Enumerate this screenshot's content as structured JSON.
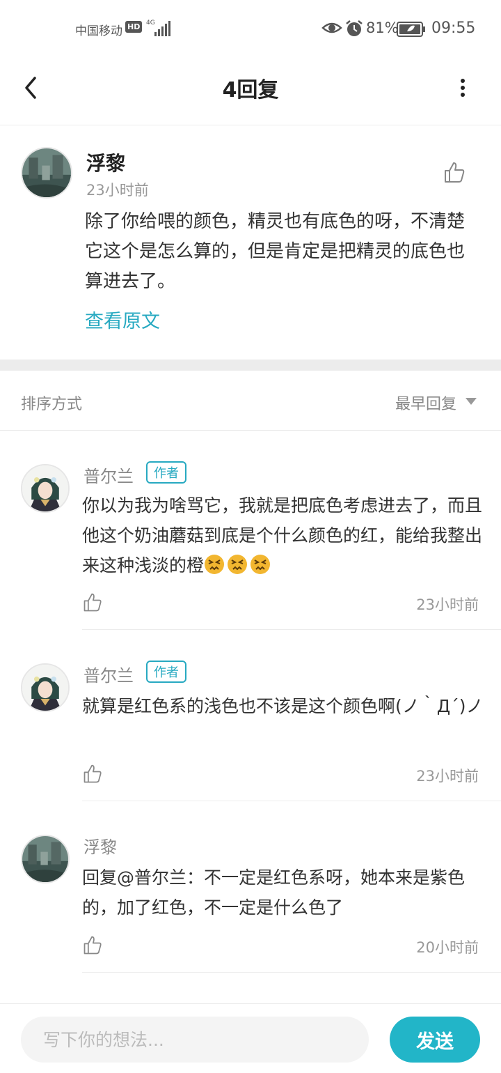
{
  "status_bar": {
    "carrier": "中国移动",
    "hd": "HD",
    "network": "4G",
    "battery_percent_text": "81%",
    "time": "09:55",
    "icons": [
      "signal-icon",
      "eye-icon",
      "alarm-icon",
      "battery-icon"
    ]
  },
  "header": {
    "title": "4回复",
    "back_icon": "chevron-left-icon",
    "more_icon": "more-vertical-icon"
  },
  "original_comment": {
    "author": "浮黎",
    "time": "23小时前",
    "text": "除了你给喂的颜色，精灵也有底色的呀，不清楚它这个是怎么算的，但是肯定是把精灵的底色也算进去了。",
    "view_original": "查看原文",
    "like_icon": "thumbs-up-icon"
  },
  "sort": {
    "label": "排序方式",
    "value": "最早回复"
  },
  "replies": [
    {
      "author": "普尔兰",
      "badge": "作者",
      "text": "你以为我为啥骂它，我就是把底色考虑进去了，而且他这个奶油蘑菇到底是个什么颜色的红，能给我整出来这种浅淡的橙",
      "emoji": [
        "persevering-face",
        "persevering-face",
        "persevering-face"
      ],
      "time": "23小时前"
    },
    {
      "author": "普尔兰",
      "badge": "作者",
      "text": "就算是红色系的浅色也不该是这个颜色啊(ノ｀Д´)ノ",
      "time": "23小时前"
    },
    {
      "author": "浮黎",
      "badge": "",
      "text": "回复@普尔兰：不一定是红色系呀，她本来是紫色的，加了红色，不一定是什么色了",
      "time": "20小时前"
    }
  ],
  "composer": {
    "placeholder": "写下你的想法...",
    "send_label": "发送"
  },
  "colors": {
    "accent": "#22b5c8",
    "link": "#27a9c1",
    "secondary_text": "#999999",
    "divider": "#ececec"
  }
}
